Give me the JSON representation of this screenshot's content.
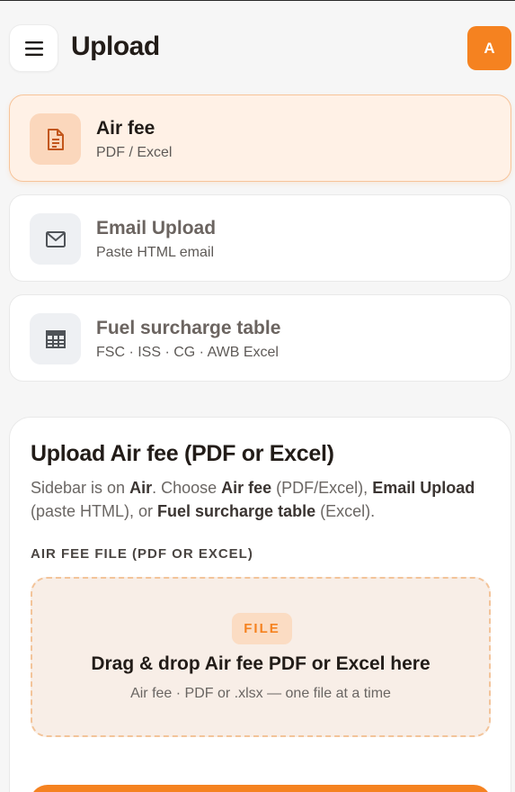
{
  "header": {
    "title": "Upload",
    "avatar_letter": "A",
    "menu_icon": "hamburger-menu-icon"
  },
  "options": [
    {
      "title": "Air fee",
      "subtitle": "PDF / Excel",
      "icon": "document-icon",
      "active": true
    },
    {
      "title": "Email Upload",
      "subtitle": "Paste HTML email",
      "icon": "envelope-icon",
      "active": false
    },
    {
      "title": "Fuel surcharge table",
      "subtitle": "FSC · ISS · CG · AWB Excel",
      "icon": "table-icon",
      "active": false
    }
  ],
  "panel": {
    "title": "Upload Air fee (PDF or Excel)",
    "desc": {
      "p1": "Sidebar is on ",
      "b1": "Air",
      "p2": ". Choose ",
      "b2": "Air fee",
      "p3": " (PDF/Excel), ",
      "b3": "Email Upload",
      "p4": " (paste HTML), or ",
      "b4": "Fuel surcharge table",
      "p5": " (Excel)."
    },
    "field_label": "AIR FEE FILE (PDF OR EXCEL)",
    "dropzone": {
      "badge": "FILE",
      "title": "Drag & drop Air fee PDF or Excel here",
      "subtitle": "Air fee · PDF or .xlsx — one file at a time"
    }
  },
  "colors": {
    "accent": "#f58220",
    "active_bg": "#fff1e6",
    "dropzone_bg": "#f8eee7"
  }
}
